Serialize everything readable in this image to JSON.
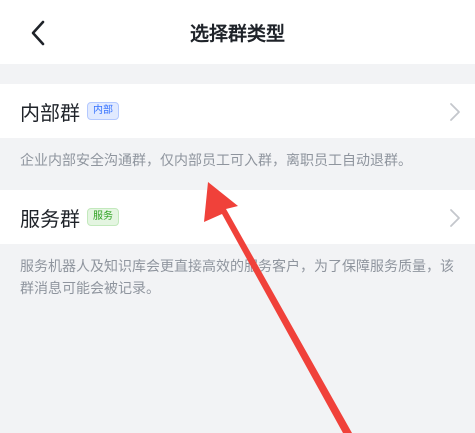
{
  "header": {
    "back_icon": "chevron-left-icon",
    "title": "选择群类型"
  },
  "options": [
    {
      "label": "内部群",
      "tag": "内部",
      "tag_color": "#3370ff",
      "description": "企业内部安全沟通群，仅内部员工可入群，离职员工自动退群。"
    },
    {
      "label": "服务群",
      "tag": "服务",
      "tag_color": "#2ea121",
      "description": "服务机器人及知识库会更直接高效的服务客户，为了保障服务质量，该群消息可能会被记录。"
    }
  ],
  "colors": {
    "background": "#f2f3f5",
    "annotation_arrow": "#f0413a"
  }
}
